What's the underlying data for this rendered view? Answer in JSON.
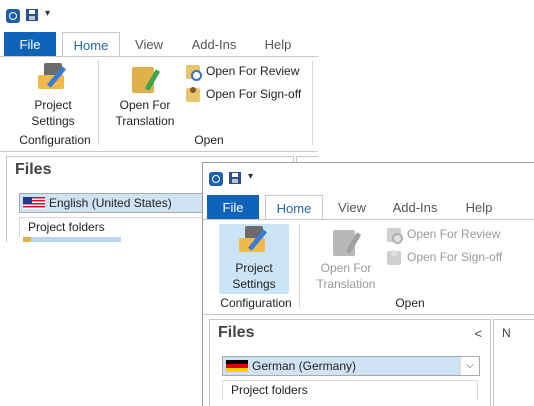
{
  "back_window": {
    "tabs": [
      "File",
      "Home",
      "View",
      "Add-Ins",
      "Help"
    ],
    "ribbon": {
      "project_settings": "Project\nSettings",
      "open_for_translation": "Open For\nTranslation",
      "open_for_review": "Open For Review",
      "open_for_signoff": "Open For Sign-off",
      "group_configuration": "Configuration",
      "group_open": "Open"
    },
    "files": {
      "title": "Files",
      "language": "English (United States)",
      "project_folders": "Project folders"
    }
  },
  "front_window": {
    "tabs": [
      "File",
      "Home",
      "View",
      "Add-Ins",
      "Help"
    ],
    "ribbon": {
      "project_settings": "Project\nSettings",
      "open_for_translation": "Open For\nTranslation",
      "open_for_review": "Open For Review",
      "open_for_signoff": "Open For Sign-off",
      "group_configuration": "Configuration",
      "group_open": "Open"
    },
    "files": {
      "title": "Files",
      "collapse_glyph": "<",
      "language": "German (Germany)",
      "project_folders": "Project folders",
      "side_pane_letter": "N"
    }
  },
  "colors": {
    "file_tab": "#0f63b8",
    "home_tab_text": "#2b66b0",
    "selected_button": "#cce4f7"
  }
}
